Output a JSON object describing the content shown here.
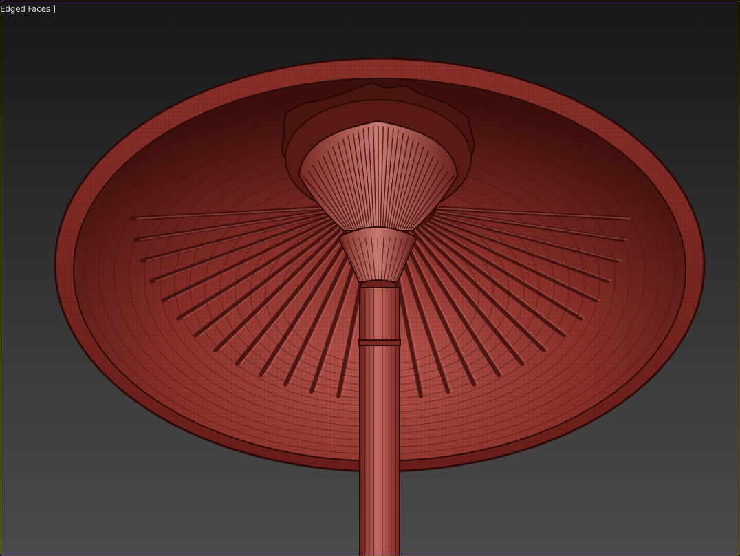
{
  "viewport": {
    "label": "Edged Faces ]",
    "border_color": "#c9c92a",
    "background_top": "#171717",
    "background_bottom": "#4a4a4a"
  },
  "model": {
    "object": "umbrella-lamp-underside",
    "base_color": "#9c3a32",
    "edge_color": "#3a0d0b",
    "rib_count": 28
  }
}
